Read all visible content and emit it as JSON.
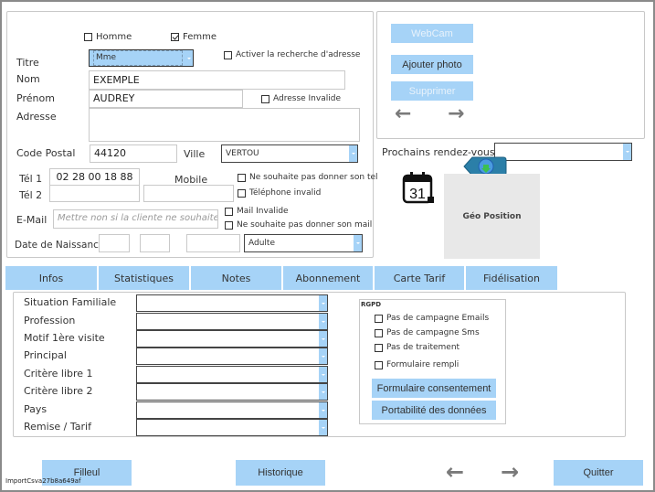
{
  "identity": {
    "gender_male_label": "Homme",
    "gender_male_checked": false,
    "gender_female_label": "Femme",
    "gender_female_checked": true,
    "titre_label": "Titre",
    "titre_value": "Mme",
    "address_search_label": "Activer la recherche d'adresse",
    "nom_label": "Nom",
    "nom_value": "EXEMPLE",
    "prenom_label": "Prénom",
    "prenom_value": "AUDREY",
    "address_invalid_label": "Adresse Invalide",
    "adresse_label": "Adresse",
    "adresse_value": "",
    "code_postal_label": "Code Postal",
    "code_postal_value": "44120",
    "ville_label": "Ville",
    "ville_value": "VERTOU",
    "tel1_label": "Tél 1",
    "tel1_value": "02 28 00 18 88",
    "tel2_label": "Tél 2",
    "tel2_value": "",
    "mobile_label": "Mobile",
    "mobile_value": "",
    "mobile2_value": "",
    "no_phone_label": "Ne souhaite pas donner son tel",
    "phone_invalid_label": "Téléphone invalid",
    "email_label": "E-Mail",
    "email_placeholder": "Mettre non si la cliente ne souhaite pa",
    "mail_invalid_label": "Mail Invalide",
    "no_mail_label": "Ne souhaite pas donner son mail",
    "dob_label": "Date de Naissance",
    "dob_day": "",
    "dob_month": "",
    "dob_year": "",
    "age_category": "Adulte"
  },
  "photo": {
    "webcam_label": "WebCam",
    "add_photo_label": "Ajouter photo",
    "delete_label": "Supprimer",
    "prev_icon": "arrow-left",
    "next_icon": "arrow-right"
  },
  "appointments": {
    "label": "Prochains rendez-vous",
    "value": "",
    "calendar_day": "31",
    "geo_label": "Géo Position"
  },
  "tabs": [
    {
      "label": "Infos"
    },
    {
      "label": "Statistiques"
    },
    {
      "label": "Notes"
    },
    {
      "label": "Abonnement"
    },
    {
      "label": "Carte Tarif"
    },
    {
      "label": "Fidélisation"
    }
  ],
  "infos": {
    "fields": [
      {
        "label": "Situation Familiale",
        "value": ""
      },
      {
        "label": "Profession",
        "value": ""
      },
      {
        "label": "Motif 1ère visite",
        "value": ""
      },
      {
        "label": "Principal",
        "value": ""
      },
      {
        "label": "Critère libre 1",
        "value": ""
      },
      {
        "label": "Critère libre 2",
        "value": ""
      },
      {
        "label": "Pays",
        "value": ""
      },
      {
        "label": "Remise / Tarif",
        "value": ""
      }
    ],
    "rgpd": {
      "title": "RGPD",
      "options": [
        {
          "label": "Pas de campagne Emails",
          "checked": false
        },
        {
          "label": "Pas de campagne Sms",
          "checked": false
        },
        {
          "label": "Pas de traitement",
          "checked": false
        },
        {
          "label": "Formulaire rempli",
          "checked": false
        }
      ],
      "consent_button": "Formulaire consentement",
      "portability_button": "Portabilité des données"
    }
  },
  "footer": {
    "filleul_label": "Filleul",
    "historique_label": "Historique",
    "quitter_label": "Quitter",
    "import_text": "ImportCsva27b8a649af"
  }
}
